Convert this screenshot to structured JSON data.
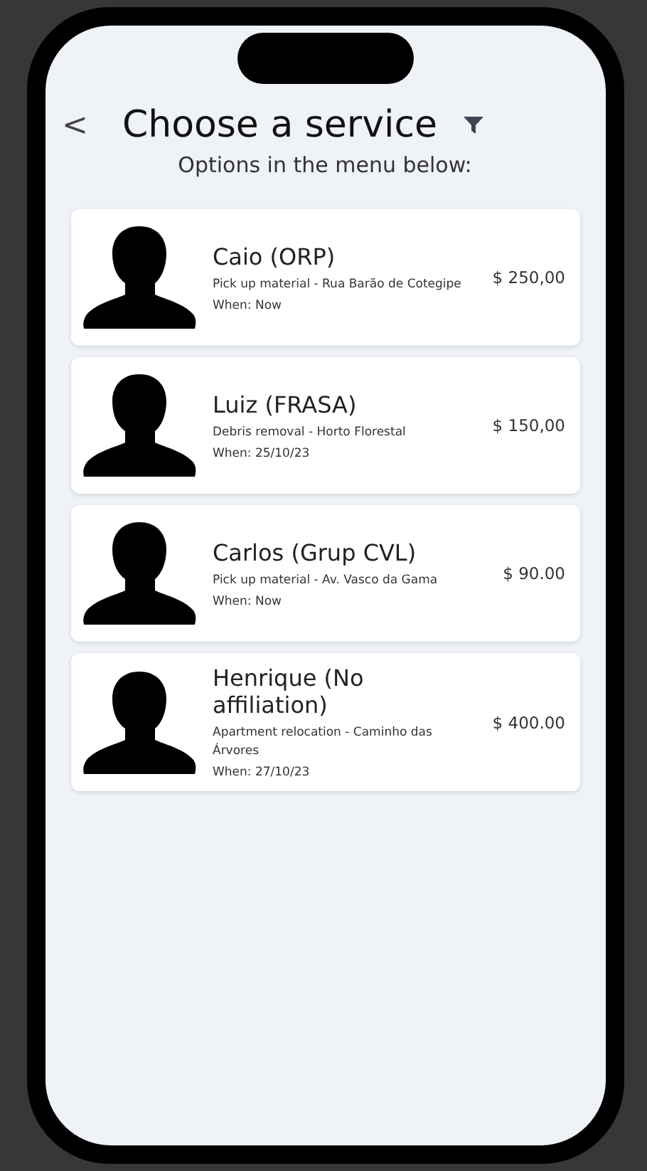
{
  "header": {
    "back": "<",
    "title": "Choose a service",
    "subtitle": "Options in the menu below:"
  },
  "services": [
    {
      "name": "Caio (ORP)",
      "description": "Pick up material - Rua Barão de Cotegipe",
      "when": "When: Now",
      "price": "$ 250,00"
    },
    {
      "name": "Luiz (FRASA)",
      "description": "Debris removal - Horto Florestal",
      "when": "When: 25/10/23",
      "price": "$ 150,00"
    },
    {
      "name": "Carlos (Grup CVL)",
      "description": "Pick up material - Av. Vasco da Gama",
      "when": "When: Now",
      "price": "$ 90.00"
    },
    {
      "name": "Henrique (No affiliation)",
      "description": "Apartment relocation - Caminho das Árvores",
      "when": "When: 27/10/23",
      "price": "$ 400.00"
    }
  ]
}
